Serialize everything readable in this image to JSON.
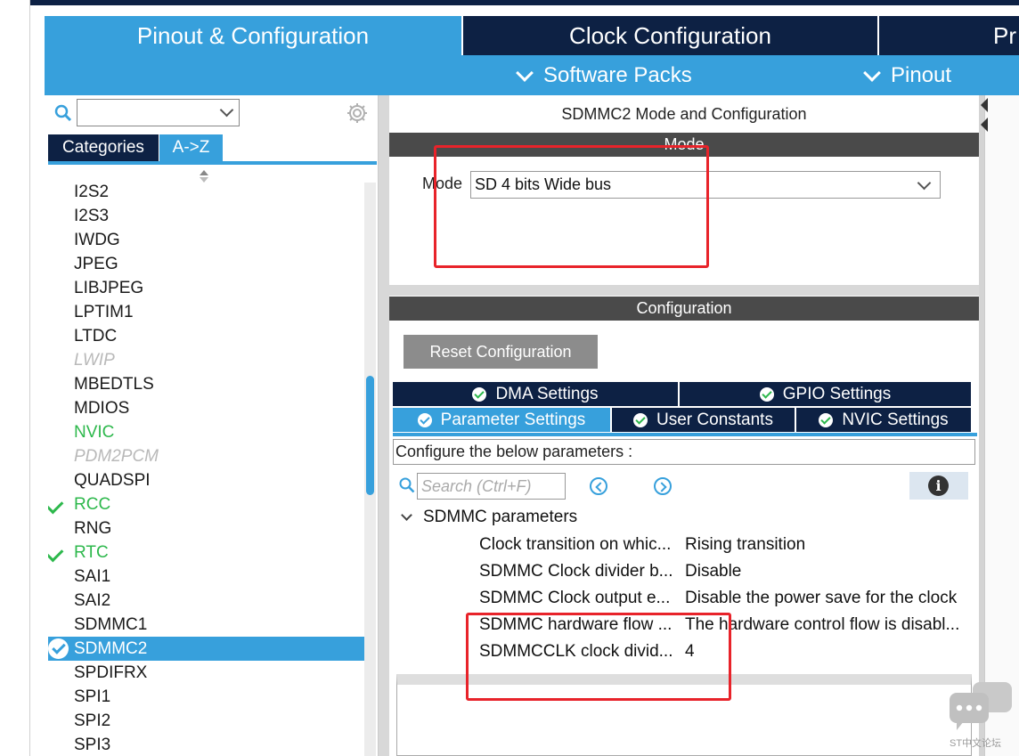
{
  "tabs": {
    "pinout": "Pinout & Configuration",
    "clock": "Clock Configuration",
    "project": "Pr"
  },
  "subbar": {
    "software_packs": "Software Packs",
    "pinout": "Pinout"
  },
  "sidebar": {
    "search_value": "",
    "tab_categories": "Categories",
    "tab_az": "A->Z",
    "items": [
      {
        "label": "I2S2",
        "state": "normal"
      },
      {
        "label": "I2S3",
        "state": "normal"
      },
      {
        "label": "IWDG",
        "state": "normal"
      },
      {
        "label": "JPEG",
        "state": "normal"
      },
      {
        "label": "LIBJPEG",
        "state": "normal"
      },
      {
        "label": "LPTIM1",
        "state": "normal"
      },
      {
        "label": "LTDC",
        "state": "normal"
      },
      {
        "label": "LWIP",
        "state": "disabled"
      },
      {
        "label": "MBEDTLS",
        "state": "normal"
      },
      {
        "label": "MDIOS",
        "state": "normal"
      },
      {
        "label": "NVIC",
        "state": "green"
      },
      {
        "label": "PDM2PCM",
        "state": "disabled"
      },
      {
        "label": "QUADSPI",
        "state": "normal"
      },
      {
        "label": "RCC",
        "state": "checked"
      },
      {
        "label": "RNG",
        "state": "normal"
      },
      {
        "label": "RTC",
        "state": "checked"
      },
      {
        "label": "SAI1",
        "state": "normal"
      },
      {
        "label": "SAI2",
        "state": "normal"
      },
      {
        "label": "SDMMC1",
        "state": "normal"
      },
      {
        "label": "SDMMC2",
        "state": "selected"
      },
      {
        "label": "SPDIFRX",
        "state": "normal"
      },
      {
        "label": "SPI1",
        "state": "normal"
      },
      {
        "label": "SPI2",
        "state": "normal"
      },
      {
        "label": "SPI3",
        "state": "normal"
      }
    ]
  },
  "main": {
    "title": "SDMMC2 Mode and Configuration",
    "mode_header": "Mode",
    "mode_label": "Mode",
    "mode_value": "SD 4 bits Wide bus",
    "config_header": "Configuration",
    "reset_button": "Reset Configuration",
    "tabs_row1": [
      {
        "label": "DMA Settings"
      },
      {
        "label": "GPIO Settings"
      }
    ],
    "tabs_row2": [
      {
        "label": "Parameter Settings",
        "active": true
      },
      {
        "label": "User Constants"
      },
      {
        "label": "NVIC Settings"
      }
    ],
    "hint": "Configure the below parameters :",
    "search_placeholder": "Search (Ctrl+F)",
    "group_label": "SDMMC parameters",
    "params": [
      {
        "name": "Clock transition on whic...",
        "value": "Rising transition"
      },
      {
        "name": "SDMMC Clock divider b...",
        "value": "Disable"
      },
      {
        "name": "SDMMC Clock output e...",
        "value": "Disable the power save for the clock"
      },
      {
        "name": "SDMMC hardware flow ...",
        "value": "The hardware control flow is disabl..."
      },
      {
        "name": "SDMMCCLK clock divid...",
        "value": "4"
      }
    ]
  },
  "watermark": "ST中文论坛",
  "colors": {
    "accent_blue": "#37a0dc",
    "navy": "#0d2144",
    "highlight_red": "#e8232a",
    "ok_green": "#2db84c"
  }
}
